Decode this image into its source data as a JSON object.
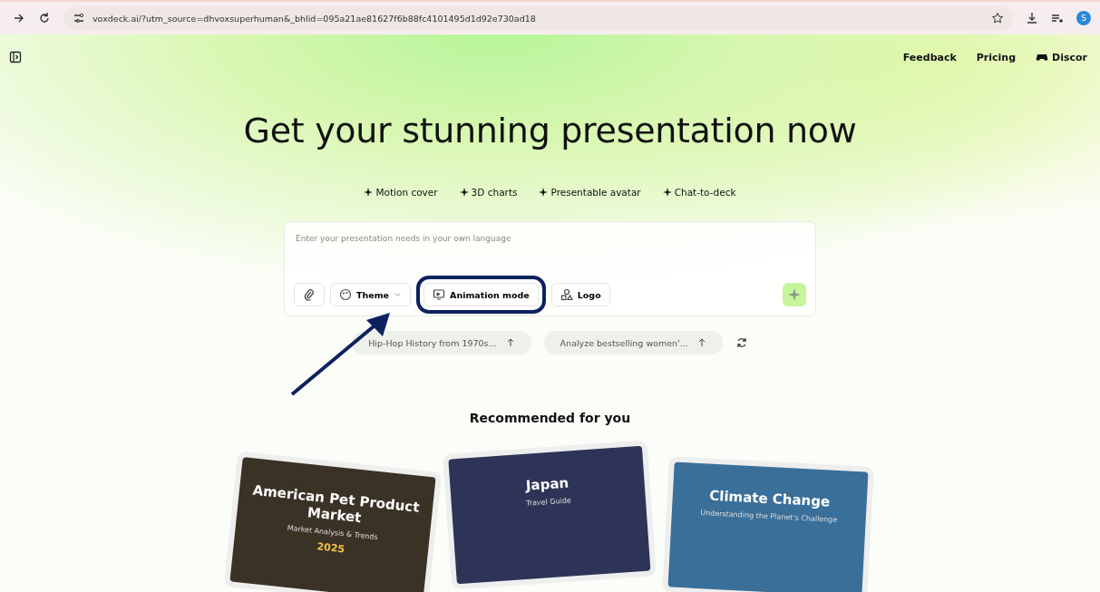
{
  "browser": {
    "url": "voxdeck.ai/?utm_source=dhvoxsuperhuman&_bhlid=095a21ae81627f6b88fc4101495d1d92e730ad18",
    "profile_initial": "S"
  },
  "nav": [
    "Feedback",
    "Pricing",
    "Discor"
  ],
  "headline": "Get your stunning presentation now",
  "features": [
    "Motion cover",
    "3D charts",
    "Presentable avatar",
    "Chat-to-deck"
  ],
  "prompt": {
    "placeholder": "Enter your presentation needs in your own language"
  },
  "tools": [
    {
      "kind": "attach"
    },
    {
      "kind": "theme",
      "label": "Theme"
    },
    {
      "kind": "animation",
      "label": "Animation mode",
      "highlighted": true
    },
    {
      "kind": "logo",
      "label": "Logo"
    }
  ],
  "suggestions": [
    "Hip-Hop History from 1970s...",
    "Analyze bestselling women'..."
  ],
  "section_title": "Recommended for you",
  "cards": [
    {
      "kind": "pet",
      "title": "American Pet Product Market",
      "subtitle": "Market Analysis & Trends",
      "year": "2025"
    },
    {
      "kind": "japan",
      "title": "Japan",
      "subtitle": "Travel Guide"
    },
    {
      "kind": "climate",
      "title": "Climate Change",
      "subtitle": "Understanding the Planet's Challenge"
    }
  ]
}
